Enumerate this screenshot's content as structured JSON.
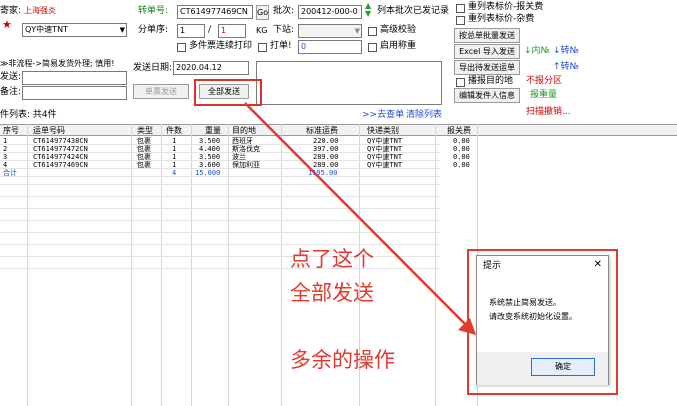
{
  "form": {
    "sender_label": "寄家:",
    "sender_value": "上海强炎",
    "channel_value": "QY中速TNT",
    "tracking_label": "转单号:",
    "tracking_value": "CT614977469CN",
    "go_button": "Go",
    "batch_label": "批次:",
    "batch_value": "200412-000-0",
    "batch_list_label": "列本批次已发记录",
    "sub_order_label": "分单序:",
    "sub_order_value": "1",
    "sub_order_sep": "/",
    "sub_order_total": "1",
    "kg_label": "KG",
    "station_label": "下站:",
    "advanced_check_label": "高级校验",
    "multi_print_label": "多件票连续打印",
    "print_label": "打单!",
    "print_value": "0",
    "scale_label": "启用称重",
    "note_flow": "≫非流程->简易发货外理; 慎用!",
    "send_label": "发送:",
    "remark_label": "备注:",
    "date_label": "发送日期:",
    "date_value": "2020.04.12",
    "single_send_button": "单票发送",
    "all_send_button": "全部发送"
  },
  "right_panel": {
    "check1": "重列表标价-报关费",
    "check2": "重列表标价-杂费",
    "batch_send_button": "按总单批量发送",
    "excel_import_button": "Excel 导入发送",
    "export_pending_button": "导出待发送运单",
    "inner_no": "内№",
    "trans_no": "转№",
    "trans_no2": "转№",
    "scan_target_label": "播报目的地",
    "no_report_label": "不报分区",
    "edit_sender_button": "编辑发件人信息",
    "report_weight": "报重量",
    "scan_cancel": "扫描撤销..."
  },
  "list": {
    "count_label": "件列表: 共4件",
    "go_query": ">>去查单",
    "clear_list": "清除列表",
    "headers": [
      "序号",
      "运单号码",
      "类型",
      "件数",
      "重量",
      "目的地",
      "标准运费",
      "快递类别",
      "报关费"
    ],
    "rows": [
      [
        "1",
        "CT614977438CN",
        "包裹",
        "1",
        "3.500",
        "西班牙",
        "220.00",
        "QY中速TNT",
        "0.00"
      ],
      [
        "2",
        "CT614977472CN",
        "包裹",
        "1",
        "4.400",
        "斯洛伐克",
        "397.00",
        "QY中速TNT",
        "0.00"
      ],
      [
        "3",
        "CT614977424CN",
        "包裹",
        "1",
        "3.500",
        "波兰",
        "289.00",
        "QY中速TNT",
        "0.00"
      ],
      [
        "4",
        "CT614977469CN",
        "包裹",
        "1",
        "3.600",
        "保加利亚",
        "289.00",
        "QY中速TNT",
        "0.00"
      ]
    ],
    "total_label": "合计",
    "total_count": "4",
    "total_weight": "15.000",
    "total_fee": "1195.00"
  },
  "annotation": {
    "line1": "点了这个",
    "line2": "全部发送",
    "line3": "多余的操作"
  },
  "dialog": {
    "title": "提示",
    "close": "✕",
    "message1": "系统禁止简易发送。",
    "message2": "请改变系统初始化设置。",
    "ok_button": "确定"
  }
}
